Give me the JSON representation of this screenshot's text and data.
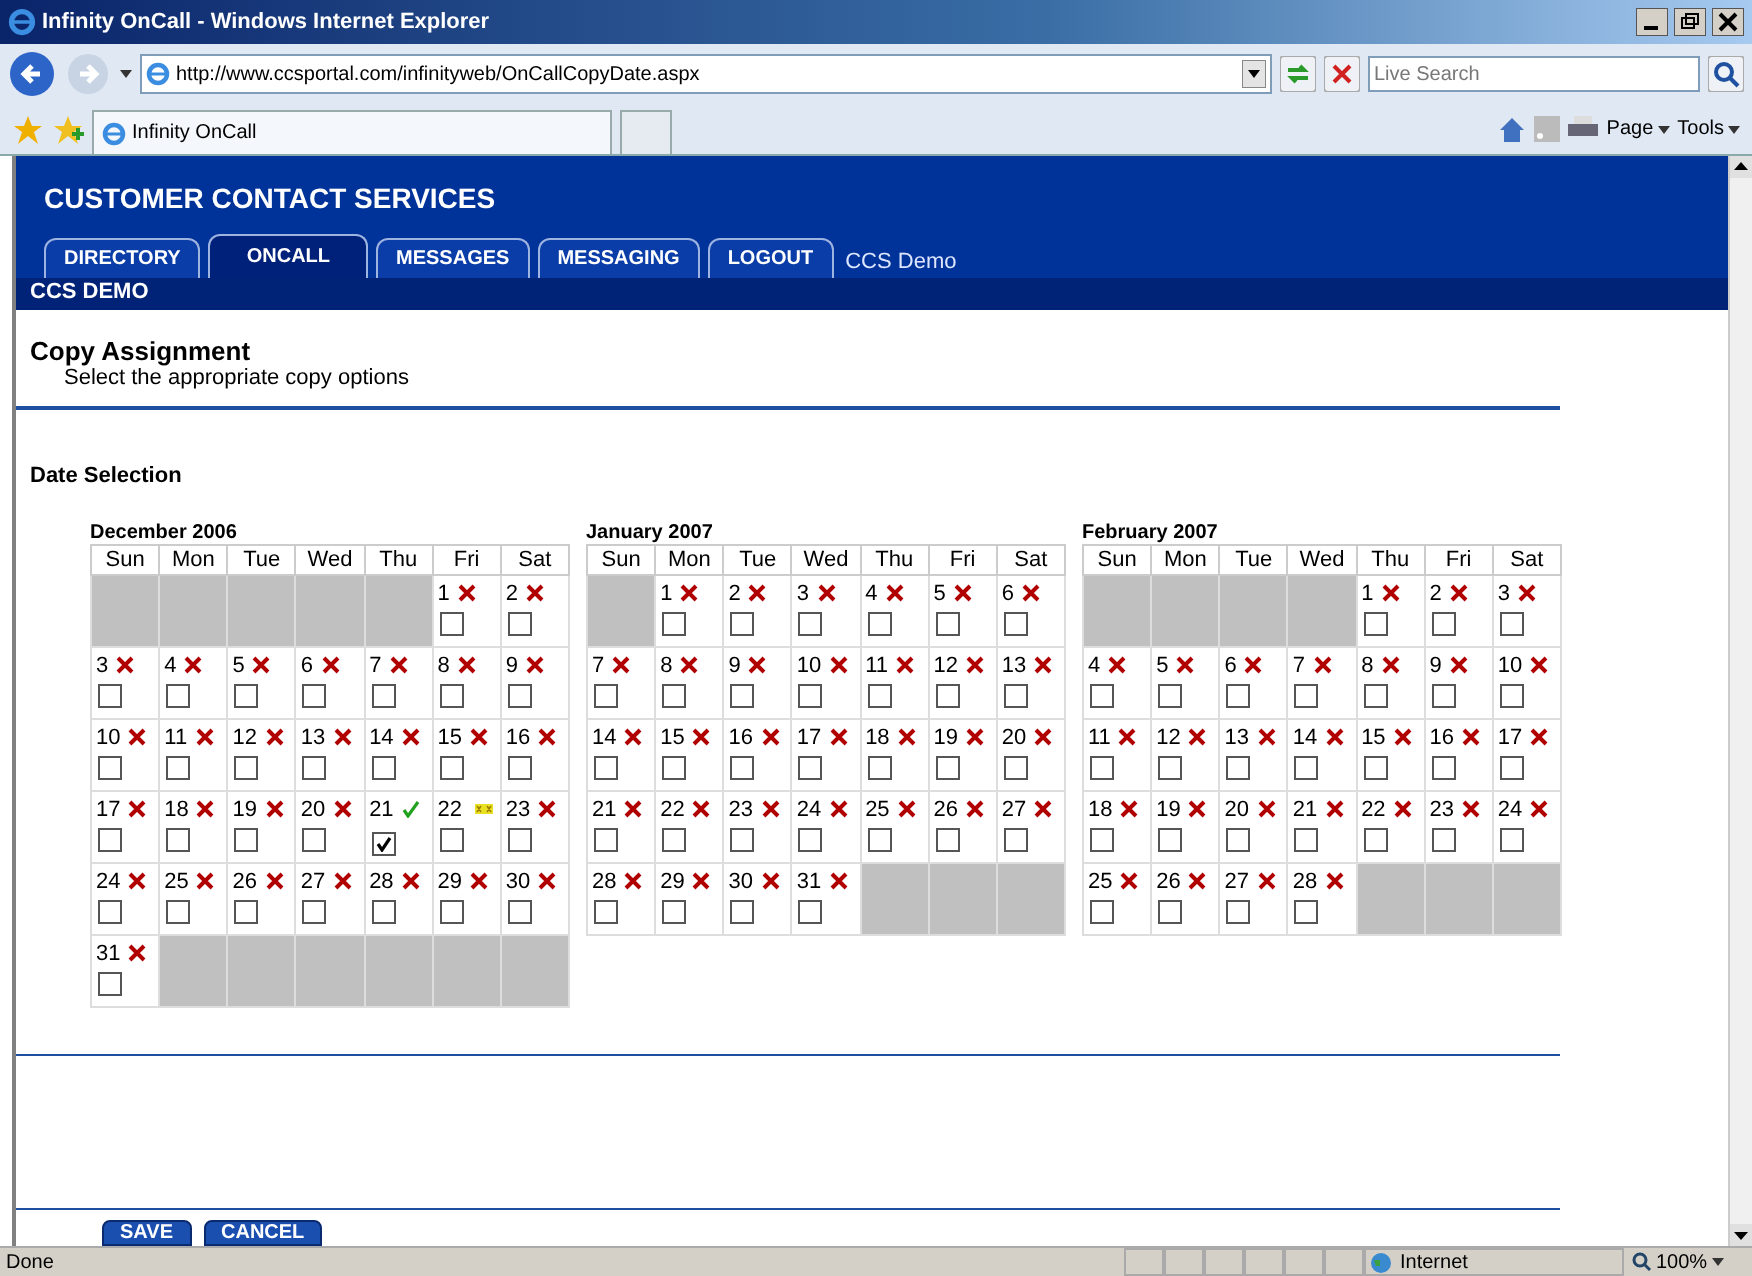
{
  "browser": {
    "title": "Infinity OnCall - Windows Internet Explorer",
    "address": "http://www.ccsportal.com/infinityweb/OnCallCopyDate.aspx",
    "search": {
      "placeholder": "Live Search"
    },
    "tab_title": "Infinity OnCall",
    "menus": [
      "Page",
      "Tools"
    ]
  },
  "page": {
    "site_title": "CUSTOMER CONTACT SERVICES",
    "tabs": [
      {
        "label": "DIRECTORY",
        "selected": false
      },
      {
        "label": "ONCALL",
        "selected": true
      },
      {
        "label": "MESSAGES",
        "selected": false
      },
      {
        "label": "MESSAGING",
        "selected": false
      },
      {
        "label": "LOGOUT",
        "selected": false
      }
    ],
    "user_label": "CCS Demo",
    "banner": "CCS DEMO",
    "heading": "Copy Assignment",
    "subheading": "Select the appropriate copy options",
    "section_label": "Date Selection",
    "months": [
      {
        "title": "December 2006",
        "weekdays": [
          "Sun",
          "Mon",
          "Tue",
          "Wed",
          "Thu",
          "Fri",
          "Sat"
        ],
        "weeks": [
          [
            {
              "kind": "empty"
            },
            {
              "kind": "empty"
            },
            {
              "kind": "empty"
            },
            {
              "kind": "empty"
            },
            {
              "kind": "empty"
            },
            {
              "kind": "unassigned",
              "date": "1",
              "checked": false
            },
            {
              "kind": "unassigned",
              "date": "2",
              "checked": false
            }
          ],
          [
            {
              "kind": "unassigned",
              "date": "3",
              "checked": false
            },
            {
              "kind": "unassigned",
              "date": "4",
              "checked": false
            },
            {
              "kind": "unassigned",
              "date": "5",
              "checked": false
            },
            {
              "kind": "unassigned",
              "date": "6",
              "checked": false
            },
            {
              "kind": "unassigned",
              "date": "7",
              "checked": false
            },
            {
              "kind": "unassigned",
              "date": "8",
              "checked": false
            },
            {
              "kind": "unassigned",
              "date": "9",
              "checked": false
            }
          ],
          [
            {
              "kind": "unassigned",
              "date": "10",
              "checked": false
            },
            {
              "kind": "unassigned",
              "date": "11",
              "checked": false
            },
            {
              "kind": "unassigned",
              "date": "12",
              "checked": false
            },
            {
              "kind": "unassigned",
              "date": "13",
              "checked": false
            },
            {
              "kind": "unassigned",
              "date": "14",
              "checked": false
            },
            {
              "kind": "unassigned",
              "date": "15",
              "checked": false
            },
            {
              "kind": "unassigned",
              "date": "16",
              "checked": false
            }
          ],
          [
            {
              "kind": "unassigned",
              "date": "17",
              "checked": false
            },
            {
              "kind": "unassigned",
              "date": "18",
              "checked": false
            },
            {
              "kind": "unassigned",
              "date": "19",
              "checked": false
            },
            {
              "kind": "unassigned",
              "date": "20",
              "checked": false
            },
            {
              "kind": "assigned",
              "date": "21",
              "checked": true
            },
            {
              "kind": "partial",
              "date": "22",
              "checked": false
            },
            {
              "kind": "unassigned",
              "date": "23",
              "checked": false
            }
          ],
          [
            {
              "kind": "unassigned",
              "date": "24",
              "checked": false
            },
            {
              "kind": "unassigned",
              "date": "25",
              "checked": false
            },
            {
              "kind": "unassigned",
              "date": "26",
              "checked": false
            },
            {
              "kind": "unassigned",
              "date": "27",
              "checked": false
            },
            {
              "kind": "unassigned",
              "date": "28",
              "checked": false
            },
            {
              "kind": "unassigned",
              "date": "29",
              "checked": false
            },
            {
              "kind": "unassigned",
              "date": "30",
              "checked": false
            }
          ],
          [
            {
              "kind": "unassigned",
              "date": "31",
              "checked": false
            },
            {
              "kind": "empty"
            },
            {
              "kind": "empty"
            },
            {
              "kind": "empty"
            },
            {
              "kind": "empty"
            },
            {
              "kind": "empty"
            },
            {
              "kind": "empty"
            }
          ]
        ]
      },
      {
        "title": "January 2007",
        "weekdays": [
          "Sun",
          "Mon",
          "Tue",
          "Wed",
          "Thu",
          "Fri",
          "Sat"
        ],
        "weeks": [
          [
            {
              "kind": "empty"
            },
            {
              "kind": "unassigned",
              "date": "1",
              "checked": false
            },
            {
              "kind": "unassigned",
              "date": "2",
              "checked": false
            },
            {
              "kind": "unassigned",
              "date": "3",
              "checked": false
            },
            {
              "kind": "unassigned",
              "date": "4",
              "checked": false
            },
            {
              "kind": "unassigned",
              "date": "5",
              "checked": false
            },
            {
              "kind": "unassigned",
              "date": "6",
              "checked": false
            }
          ],
          [
            {
              "kind": "unassigned",
              "date": "7",
              "checked": false
            },
            {
              "kind": "unassigned",
              "date": "8",
              "checked": false
            },
            {
              "kind": "unassigned",
              "date": "9",
              "checked": false
            },
            {
              "kind": "unassigned",
              "date": "10",
              "checked": false
            },
            {
              "kind": "unassigned",
              "date": "11",
              "checked": false
            },
            {
              "kind": "unassigned",
              "date": "12",
              "checked": false
            },
            {
              "kind": "unassigned",
              "date": "13",
              "checked": false
            }
          ],
          [
            {
              "kind": "unassigned",
              "date": "14",
              "checked": false
            },
            {
              "kind": "unassigned",
              "date": "15",
              "checked": false
            },
            {
              "kind": "unassigned",
              "date": "16",
              "checked": false
            },
            {
              "kind": "unassigned",
              "date": "17",
              "checked": false
            },
            {
              "kind": "unassigned",
              "date": "18",
              "checked": false
            },
            {
              "kind": "unassigned",
              "date": "19",
              "checked": false
            },
            {
              "kind": "unassigned",
              "date": "20",
              "checked": false
            }
          ],
          [
            {
              "kind": "unassigned",
              "date": "21",
              "checked": false
            },
            {
              "kind": "unassigned",
              "date": "22",
              "checked": false
            },
            {
              "kind": "unassigned",
              "date": "23",
              "checked": false
            },
            {
              "kind": "unassigned",
              "date": "24",
              "checked": false
            },
            {
              "kind": "unassigned",
              "date": "25",
              "checked": false
            },
            {
              "kind": "unassigned",
              "date": "26",
              "checked": false
            },
            {
              "kind": "unassigned",
              "date": "27",
              "checked": false
            }
          ],
          [
            {
              "kind": "unassigned",
              "date": "28",
              "checked": false
            },
            {
              "kind": "unassigned",
              "date": "29",
              "checked": false
            },
            {
              "kind": "unassigned",
              "date": "30",
              "checked": false
            },
            {
              "kind": "unassigned",
              "date": "31",
              "checked": false
            },
            {
              "kind": "empty"
            },
            {
              "kind": "empty"
            },
            {
              "kind": "empty"
            }
          ]
        ]
      },
      {
        "title": "February 2007",
        "weekdays": [
          "Sun",
          "Mon",
          "Tue",
          "Wed",
          "Thu",
          "Fri",
          "Sat"
        ],
        "weeks": [
          [
            {
              "kind": "empty"
            },
            {
              "kind": "empty"
            },
            {
              "kind": "empty"
            },
            {
              "kind": "empty"
            },
            {
              "kind": "unassigned",
              "date": "1",
              "checked": false
            },
            {
              "kind": "unassigned",
              "date": "2",
              "checked": false
            },
            {
              "kind": "unassigned",
              "date": "3",
              "checked": false
            }
          ],
          [
            {
              "kind": "unassigned",
              "date": "4",
              "checked": false
            },
            {
              "kind": "unassigned",
              "date": "5",
              "checked": false
            },
            {
              "kind": "unassigned",
              "date": "6",
              "checked": false
            },
            {
              "kind": "unassigned",
              "date": "7",
              "checked": false
            },
            {
              "kind": "unassigned",
              "date": "8",
              "checked": false
            },
            {
              "kind": "unassigned",
              "date": "9",
              "checked": false
            },
            {
              "kind": "unassigned",
              "date": "10",
              "checked": false
            }
          ],
          [
            {
              "kind": "unassigned",
              "date": "11",
              "checked": false
            },
            {
              "kind": "unassigned",
              "date": "12",
              "checked": false
            },
            {
              "kind": "unassigned",
              "date": "13",
              "checked": false
            },
            {
              "kind": "unassigned",
              "date": "14",
              "checked": false
            },
            {
              "kind": "unassigned",
              "date": "15",
              "checked": false
            },
            {
              "kind": "unassigned",
              "date": "16",
              "checked": false
            },
            {
              "kind": "unassigned",
              "date": "17",
              "checked": false
            }
          ],
          [
            {
              "kind": "unassigned",
              "date": "18",
              "checked": false
            },
            {
              "kind": "unassigned",
              "date": "19",
              "checked": false
            },
            {
              "kind": "unassigned",
              "date": "20",
              "checked": false
            },
            {
              "kind": "unassigned",
              "date": "21",
              "checked": false
            },
            {
              "kind": "unassigned",
              "date": "22",
              "checked": false
            },
            {
              "kind": "unassigned",
              "date": "23",
              "checked": false
            },
            {
              "kind": "unassigned",
              "date": "24",
              "checked": false
            }
          ],
          [
            {
              "kind": "unassigned",
              "date": "25",
              "checked": false
            },
            {
              "kind": "unassigned",
              "date": "26",
              "checked": false
            },
            {
              "kind": "unassigned",
              "date": "27",
              "checked": false
            },
            {
              "kind": "unassigned",
              "date": "28",
              "checked": false
            },
            {
              "kind": "empty"
            },
            {
              "kind": "empty"
            },
            {
              "kind": "empty"
            }
          ]
        ]
      }
    ],
    "buttons": [
      "SAVE",
      "CANCEL"
    ]
  },
  "status_bar": {
    "text": "Done",
    "zone": "Internet",
    "zoom": "100%"
  }
}
